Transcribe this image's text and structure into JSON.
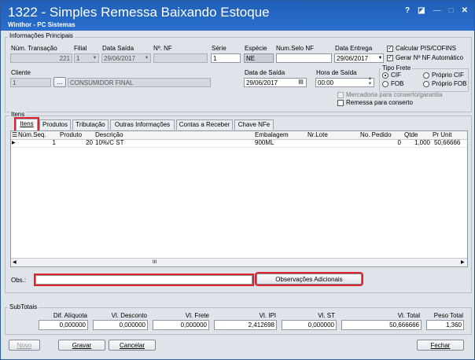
{
  "window": {
    "title": "1322 - Simples Remessa Baixando Estoque",
    "subtitle": "Winthor - PC Sistemas",
    "help": "?",
    "minimize": "—",
    "close": "✕"
  },
  "principal": {
    "group_title": "Informações Principais",
    "num_transacao": {
      "label": "Núm. Transação",
      "value": "221"
    },
    "filial": {
      "label": "Filial",
      "value": "1"
    },
    "data_saida": {
      "label": "Data Saída",
      "value": "29/06/2017"
    },
    "num_nf": {
      "label": "Nº. NF",
      "value": ""
    },
    "serie": {
      "label": "Série",
      "value": "1"
    },
    "especie": {
      "label": "Espécie",
      "value": "NE"
    },
    "num_selo": {
      "label": "Num.Selo NF",
      "value": ""
    },
    "data_entrega": {
      "label": "Data Entrega",
      "value": "29/06/2017"
    },
    "calc_pis": {
      "label": "Calcular PIS/COFINS",
      "checked": true
    },
    "gerar_nf": {
      "label": "Gerar Nº NF Automático",
      "checked": true
    },
    "cliente": {
      "label": "Cliente",
      "code": "1",
      "name": "CONSUMIDOR FINAL"
    },
    "data_de_saida": {
      "label": "Data de Saída",
      "value": "29/06/2017"
    },
    "hora_saida": {
      "label": "Hora de Saída",
      "value": "00:00"
    },
    "tipo_frete": {
      "label": "Tipo Frete",
      "cif": "CIF",
      "fob": "FOB",
      "proprio_cif": "Próprio CIF",
      "proprio_fob": "Próprio FOB"
    },
    "mercadoria": "Mercadoria para conserto/garantia",
    "remessa": "Remessa para conserto"
  },
  "itens": {
    "group_title": "Itens",
    "tabs": [
      "Itens",
      "Produtos",
      "Tributação",
      "Outras Informações",
      "Contas a Receber",
      "Chave NFe"
    ],
    "columns": [
      "Núm.Seq.",
      "Produto",
      "Descrição",
      "Embalagem",
      "Nr.Lote",
      "No. Pedido",
      "Qtde",
      "Pr Unit"
    ],
    "rows": [
      {
        "seq": "1",
        "produto": "20",
        "descricao": "10%/C ST",
        "embalagem": "900ML",
        "lote": "",
        "pedido": "0",
        "qtde": "1,000",
        "preco": "50,66666"
      }
    ],
    "scroll_mark": "III"
  },
  "obs": {
    "label": "Obs.:",
    "value": "",
    "button": "Observações Adicionais"
  },
  "subtotais": {
    "group_title": "SubTotais",
    "fields": [
      {
        "label": "Dif. Alíquota",
        "value": "0,000000"
      },
      {
        "label": "Vl. Desconto",
        "value": "0,000000"
      },
      {
        "label": "Vl. Frete",
        "value": "0,000000"
      },
      {
        "label": "Vl. IPI",
        "value": "2,412698"
      },
      {
        "label": "Vl. ST",
        "value": "0,000000"
      },
      {
        "label": "Vl. Total",
        "value": "50,666666"
      },
      {
        "label": "Peso Total",
        "value": "1,360"
      }
    ]
  },
  "buttons": {
    "novo": "Novo",
    "gravar": "Gravar",
    "cancelar": "Cancelar",
    "fechar": "Fechar"
  },
  "colors": {
    "titlebar": "#2a6fcf",
    "highlight": "#e0202a",
    "background": "#dfe3ea"
  }
}
